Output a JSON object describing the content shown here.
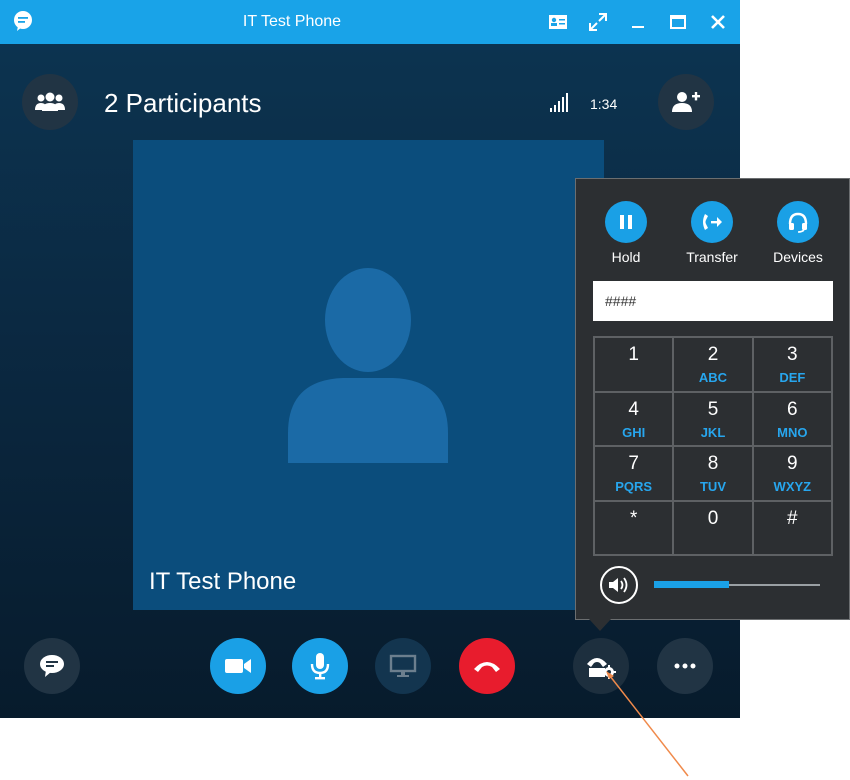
{
  "window": {
    "title": "IT Test Phone"
  },
  "header": {
    "participants_label": "2 Participants",
    "call_duration": "1:34"
  },
  "video": {
    "caller_name": "IT Test Phone"
  },
  "call_controls": {
    "actions": [
      {
        "label": "Hold",
        "icon": "pause-icon"
      },
      {
        "label": "Transfer",
        "icon": "transfer-icon"
      },
      {
        "label": "Devices",
        "icon": "headset-icon"
      }
    ],
    "dial_input_value": "####",
    "keys": [
      {
        "digit": "1",
        "letters": ""
      },
      {
        "digit": "2",
        "letters": "ABC"
      },
      {
        "digit": "3",
        "letters": "DEF"
      },
      {
        "digit": "4",
        "letters": "GHI"
      },
      {
        "digit": "5",
        "letters": "JKL"
      },
      {
        "digit": "6",
        "letters": "MNO"
      },
      {
        "digit": "7",
        "letters": "PQRS"
      },
      {
        "digit": "8",
        "letters": "TUV"
      },
      {
        "digit": "9",
        "letters": "WXYZ"
      },
      {
        "digit": "*",
        "letters": ""
      },
      {
        "digit": "0",
        "letters": ""
      },
      {
        "digit": "#",
        "letters": ""
      }
    ],
    "volume_level": 0.45
  },
  "colors": {
    "titlebar": "#19a3e8",
    "accent": "#1aa0e6",
    "hangup": "#e81c2d",
    "keypad_letters": "#27a6ee",
    "annotation_arrow": "#f08a4b"
  }
}
